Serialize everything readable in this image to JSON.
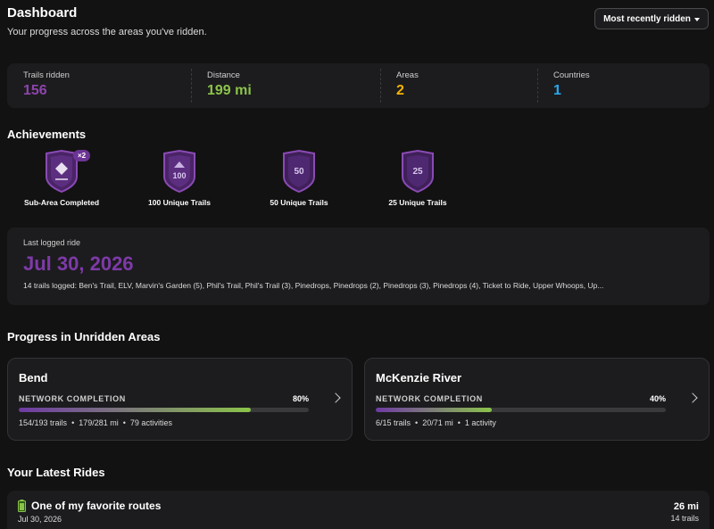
{
  "header": {
    "title": "Dashboard",
    "subtitle": "Your progress across the areas you've ridden.",
    "sort_label": "Most recently ridden"
  },
  "stats": [
    {
      "label": "Trails ridden",
      "value": "156",
      "color": "#8e44ad"
    },
    {
      "label": "Distance",
      "value": "199 mi",
      "color": "#8bc34a"
    },
    {
      "label": "Areas",
      "value": "2",
      "color": "#f5b400"
    },
    {
      "label": "Countries",
      "value": "1",
      "color": "#29a8f0"
    }
  ],
  "achievements": {
    "title": "Achievements",
    "badges": [
      {
        "label": "Sub-Area Completed",
        "icon": "diamond-icon",
        "count": "×2"
      },
      {
        "label": "100 Unique Trails",
        "icon_text": "100"
      },
      {
        "label": "50 Unique Trails",
        "icon_text": "50"
      },
      {
        "label": "25 Unique Trails",
        "icon_text": "25"
      }
    ]
  },
  "last_ride": {
    "label": "Last logged ride",
    "date": "Jul 30, 2026",
    "trails": "14 trails logged: Ben's Trail, ELV, Marvin's Garden (5), Phil's Trail, Phil's Trail (3), Pinedrops, Pinedrops (2), Pinedrops (3), Pinedrops (4), Ticket to Ride, Upper Whoops, Up..."
  },
  "progress": {
    "title": "Progress in Unridden Areas",
    "areas": [
      {
        "name": "Bend",
        "label": "NETWORK COMPLETION",
        "percent_label": "80%",
        "percent": 80,
        "trails": "154/193 trails",
        "distance": "179/281 mi",
        "activities": "79 activities"
      },
      {
        "name": "McKenzie River",
        "label": "NETWORK COMPLETION",
        "percent_label": "40%",
        "percent": 40,
        "trails": "6/15 trails",
        "distance": "20/71 mi",
        "activities": "1 activity"
      }
    ]
  },
  "latest": {
    "title": "Your Latest Rides",
    "rides": [
      {
        "title": "One of my favorite routes",
        "icon": "battery-icon",
        "date": "Jul 30, 2026",
        "distance": "26 mi",
        "trails": "14 trails"
      }
    ]
  },
  "colors": {
    "accent_purple": "#7e3aa8",
    "accent_green": "#8bc34a"
  }
}
